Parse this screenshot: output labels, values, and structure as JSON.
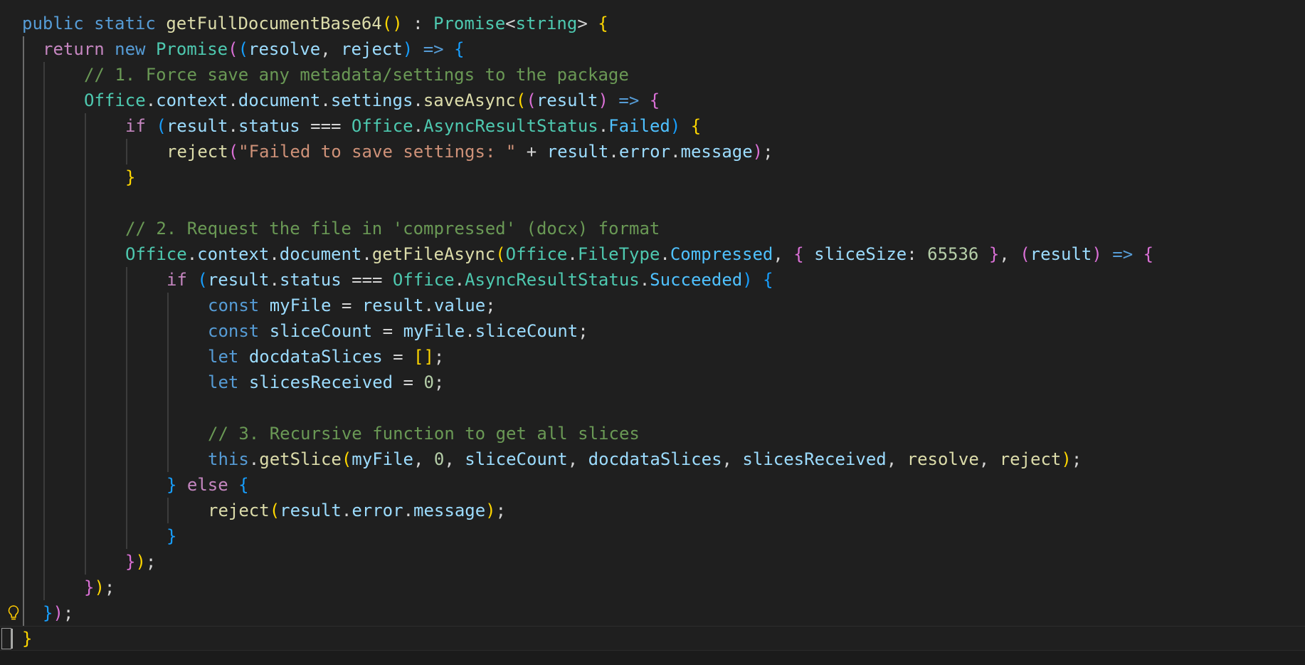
{
  "editor": {
    "language": "typescript",
    "colors": {
      "background": "#1f1f1f",
      "keyword": "#569cd6",
      "control_keyword": "#c586c0",
      "function": "#dcdcaa",
      "type": "#4ec9b0",
      "variable": "#9cdcfe",
      "string": "#ce9178",
      "comment": "#6a9955",
      "number": "#b5cea8",
      "bracket_level_1": "#ffd700",
      "bracket_level_2": "#da70d6",
      "bracket_level_3": "#179fff"
    },
    "lines": [
      {
        "indent": 0,
        "tokens": [
          [
            "public",
            "kw"
          ],
          [
            " ",
            "op"
          ],
          [
            "static",
            "kw"
          ],
          [
            " ",
            "op"
          ],
          [
            "getFullDocumentBase64",
            "fn"
          ],
          [
            "()",
            "b1"
          ],
          [
            " : ",
            "op"
          ],
          [
            "Promise",
            "ty"
          ],
          [
            "<",
            "op"
          ],
          [
            "string",
            "ty"
          ],
          [
            "> ",
            "op"
          ],
          [
            "{",
            "b1"
          ]
        ]
      },
      {
        "indent": 1,
        "tokens": [
          [
            "return",
            "kw2"
          ],
          [
            " ",
            "op"
          ],
          [
            "new",
            "kw"
          ],
          [
            " ",
            "op"
          ],
          [
            "Promise",
            "ty"
          ],
          [
            "(",
            "b2"
          ],
          [
            "(",
            "b3"
          ],
          [
            "resolve",
            "va"
          ],
          [
            ", ",
            "op"
          ],
          [
            "reject",
            "va"
          ],
          [
            ")",
            "b3"
          ],
          [
            " ",
            "op"
          ],
          [
            "=>",
            "kw"
          ],
          [
            " ",
            "op"
          ],
          [
            "{",
            "b3"
          ]
        ]
      },
      {
        "indent": 3,
        "tokens": [
          [
            "// 1. Force save any metadata/settings to the package",
            "cm"
          ]
        ]
      },
      {
        "indent": 3,
        "tokens": [
          [
            "Office",
            "ty"
          ],
          [
            ".",
            "op"
          ],
          [
            "context",
            "va"
          ],
          [
            ".",
            "op"
          ],
          [
            "document",
            "va"
          ],
          [
            ".",
            "op"
          ],
          [
            "settings",
            "va"
          ],
          [
            ".",
            "op"
          ],
          [
            "saveAsync",
            "fn"
          ],
          [
            "(",
            "b1"
          ],
          [
            "(",
            "b2"
          ],
          [
            "result",
            "va"
          ],
          [
            ")",
            "b2"
          ],
          [
            " ",
            "op"
          ],
          [
            "=>",
            "kw"
          ],
          [
            " ",
            "op"
          ],
          [
            "{",
            "b2"
          ]
        ]
      },
      {
        "indent": 5,
        "tokens": [
          [
            "if",
            "kw2"
          ],
          [
            " ",
            "op"
          ],
          [
            "(",
            "b3"
          ],
          [
            "result",
            "va"
          ],
          [
            ".",
            "op"
          ],
          [
            "status",
            "va"
          ],
          [
            " === ",
            "op"
          ],
          [
            "Office",
            "ty"
          ],
          [
            ".",
            "op"
          ],
          [
            "AsyncResultStatus",
            "ty"
          ],
          [
            ".",
            "op"
          ],
          [
            "Failed",
            "pr"
          ],
          [
            ")",
            "b3"
          ],
          [
            " ",
            "op"
          ],
          [
            "{",
            "b1"
          ]
        ]
      },
      {
        "indent": 7,
        "tokens": [
          [
            "reject",
            "fn"
          ],
          [
            "(",
            "b2"
          ],
          [
            "\"Failed to save settings: \"",
            "st"
          ],
          [
            " + ",
            "op"
          ],
          [
            "result",
            "va"
          ],
          [
            ".",
            "op"
          ],
          [
            "error",
            "va"
          ],
          [
            ".",
            "op"
          ],
          [
            "message",
            "va"
          ],
          [
            ")",
            "b2"
          ],
          [
            ";",
            "op"
          ]
        ]
      },
      {
        "indent": 5,
        "tokens": [
          [
            "}",
            "b1"
          ]
        ]
      },
      {
        "indent": 5,
        "tokens": []
      },
      {
        "indent": 5,
        "tokens": [
          [
            "// 2. Request the file in 'compressed' (docx) format",
            "cm"
          ]
        ]
      },
      {
        "indent": 5,
        "tokens": [
          [
            "Office",
            "ty"
          ],
          [
            ".",
            "op"
          ],
          [
            "context",
            "va"
          ],
          [
            ".",
            "op"
          ],
          [
            "document",
            "va"
          ],
          [
            ".",
            "op"
          ],
          [
            "getFileAsync",
            "fn"
          ],
          [
            "(",
            "b1"
          ],
          [
            "Office",
            "ty"
          ],
          [
            ".",
            "op"
          ],
          [
            "FileType",
            "ty"
          ],
          [
            ".",
            "op"
          ],
          [
            "Compressed",
            "pr"
          ],
          [
            ", ",
            "op"
          ],
          [
            "{",
            "b2"
          ],
          [
            " ",
            "op"
          ],
          [
            "sliceSize",
            "va"
          ],
          [
            ": ",
            "op"
          ],
          [
            "65536",
            "nu"
          ],
          [
            " ",
            "op"
          ],
          [
            "}",
            "b2"
          ],
          [
            ", ",
            "op"
          ],
          [
            "(",
            "b2"
          ],
          [
            "result",
            "va"
          ],
          [
            ")",
            "b2"
          ],
          [
            " ",
            "op"
          ],
          [
            "=>",
            "kw"
          ],
          [
            " ",
            "op"
          ],
          [
            "{",
            "b2"
          ]
        ]
      },
      {
        "indent": 7,
        "tokens": [
          [
            "if",
            "kw2"
          ],
          [
            " ",
            "op"
          ],
          [
            "(",
            "b3"
          ],
          [
            "result",
            "va"
          ],
          [
            ".",
            "op"
          ],
          [
            "status",
            "va"
          ],
          [
            " === ",
            "op"
          ],
          [
            "Office",
            "ty"
          ],
          [
            ".",
            "op"
          ],
          [
            "AsyncResultStatus",
            "ty"
          ],
          [
            ".",
            "op"
          ],
          [
            "Succeeded",
            "pr"
          ],
          [
            ")",
            "b3"
          ],
          [
            " ",
            "op"
          ],
          [
            "{",
            "b3"
          ]
        ]
      },
      {
        "indent": 9,
        "tokens": [
          [
            "const",
            "kw"
          ],
          [
            " ",
            "op"
          ],
          [
            "myFile",
            "va"
          ],
          [
            " = ",
            "op"
          ],
          [
            "result",
            "va"
          ],
          [
            ".",
            "op"
          ],
          [
            "value",
            "va"
          ],
          [
            ";",
            "op"
          ]
        ]
      },
      {
        "indent": 9,
        "tokens": [
          [
            "const",
            "kw"
          ],
          [
            " ",
            "op"
          ],
          [
            "sliceCount",
            "va"
          ],
          [
            " = ",
            "op"
          ],
          [
            "myFile",
            "va"
          ],
          [
            ".",
            "op"
          ],
          [
            "sliceCount",
            "va"
          ],
          [
            ";",
            "op"
          ]
        ]
      },
      {
        "indent": 9,
        "tokens": [
          [
            "let",
            "kw"
          ],
          [
            " ",
            "op"
          ],
          [
            "docdataSlices",
            "va"
          ],
          [
            " = ",
            "op"
          ],
          [
            "[]",
            "b1"
          ],
          [
            ";",
            "op"
          ]
        ]
      },
      {
        "indent": 9,
        "tokens": [
          [
            "let",
            "kw"
          ],
          [
            " ",
            "op"
          ],
          [
            "slicesReceived",
            "va"
          ],
          [
            " = ",
            "op"
          ],
          [
            "0",
            "nu"
          ],
          [
            ";",
            "op"
          ]
        ]
      },
      {
        "indent": 9,
        "tokens": []
      },
      {
        "indent": 9,
        "tokens": [
          [
            "// 3. Recursive function to get all slices",
            "cm"
          ]
        ]
      },
      {
        "indent": 9,
        "tokens": [
          [
            "this",
            "kw"
          ],
          [
            ".",
            "op"
          ],
          [
            "getSlice",
            "fn"
          ],
          [
            "(",
            "b1"
          ],
          [
            "myFile",
            "va"
          ],
          [
            ", ",
            "op"
          ],
          [
            "0",
            "nu"
          ],
          [
            ", ",
            "op"
          ],
          [
            "sliceCount",
            "va"
          ],
          [
            ", ",
            "op"
          ],
          [
            "docdataSlices",
            "va"
          ],
          [
            ", ",
            "op"
          ],
          [
            "slicesReceived",
            "va"
          ],
          [
            ", ",
            "op"
          ],
          [
            "resolve",
            "fn"
          ],
          [
            ", ",
            "op"
          ],
          [
            "reject",
            "fn"
          ],
          [
            ")",
            "b1"
          ],
          [
            ";",
            "op"
          ]
        ]
      },
      {
        "indent": 7,
        "tokens": [
          [
            "}",
            "b3"
          ],
          [
            " ",
            "op"
          ],
          [
            "else",
            "kw2"
          ],
          [
            " ",
            "op"
          ],
          [
            "{",
            "b3"
          ]
        ]
      },
      {
        "indent": 9,
        "tokens": [
          [
            "reject",
            "fn"
          ],
          [
            "(",
            "b1"
          ],
          [
            "result",
            "va"
          ],
          [
            ".",
            "op"
          ],
          [
            "error",
            "va"
          ],
          [
            ".",
            "op"
          ],
          [
            "message",
            "va"
          ],
          [
            ")",
            "b1"
          ],
          [
            ";",
            "op"
          ]
        ]
      },
      {
        "indent": 7,
        "tokens": [
          [
            "}",
            "b3"
          ]
        ]
      },
      {
        "indent": 5,
        "tokens": [
          [
            "}",
            "b2"
          ],
          [
            ")",
            "b1"
          ],
          [
            ";",
            "op"
          ]
        ]
      },
      {
        "indent": 3,
        "tokens": [
          [
            "}",
            "b2"
          ],
          [
            ")",
            "b1"
          ],
          [
            ";",
            "op"
          ]
        ]
      },
      {
        "indent": 1,
        "tokens": [
          [
            "}",
            "b3"
          ],
          [
            ")",
            "b2"
          ],
          [
            ";",
            "op"
          ]
        ],
        "lightbulb": true
      },
      {
        "indent": 0,
        "tokens": [
          [
            "}",
            "b1"
          ]
        ],
        "cursor": true
      }
    ]
  }
}
